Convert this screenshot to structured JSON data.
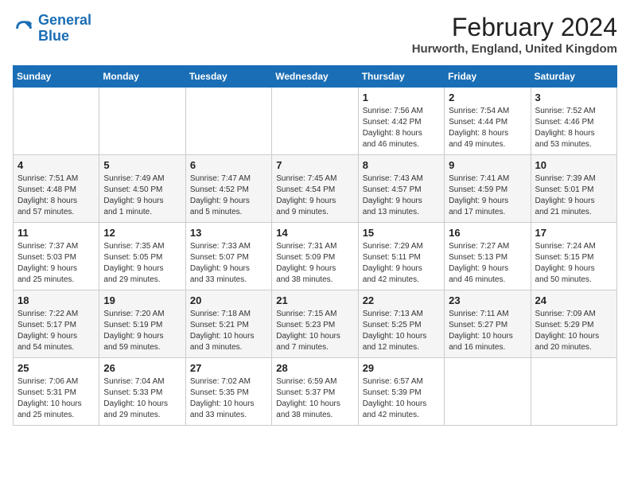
{
  "header": {
    "logo_line1": "General",
    "logo_line2": "Blue",
    "title": "February 2024",
    "subtitle": "Hurworth, England, United Kingdom"
  },
  "days_of_week": [
    "Sunday",
    "Monday",
    "Tuesday",
    "Wednesday",
    "Thursday",
    "Friday",
    "Saturday"
  ],
  "weeks": [
    [
      {
        "day": "",
        "info": ""
      },
      {
        "day": "",
        "info": ""
      },
      {
        "day": "",
        "info": ""
      },
      {
        "day": "",
        "info": ""
      },
      {
        "day": "1",
        "info": "Sunrise: 7:56 AM\nSunset: 4:42 PM\nDaylight: 8 hours\nand 46 minutes."
      },
      {
        "day": "2",
        "info": "Sunrise: 7:54 AM\nSunset: 4:44 PM\nDaylight: 8 hours\nand 49 minutes."
      },
      {
        "day": "3",
        "info": "Sunrise: 7:52 AM\nSunset: 4:46 PM\nDaylight: 8 hours\nand 53 minutes."
      }
    ],
    [
      {
        "day": "4",
        "info": "Sunrise: 7:51 AM\nSunset: 4:48 PM\nDaylight: 8 hours\nand 57 minutes."
      },
      {
        "day": "5",
        "info": "Sunrise: 7:49 AM\nSunset: 4:50 PM\nDaylight: 9 hours\nand 1 minute."
      },
      {
        "day": "6",
        "info": "Sunrise: 7:47 AM\nSunset: 4:52 PM\nDaylight: 9 hours\nand 5 minutes."
      },
      {
        "day": "7",
        "info": "Sunrise: 7:45 AM\nSunset: 4:54 PM\nDaylight: 9 hours\nand 9 minutes."
      },
      {
        "day": "8",
        "info": "Sunrise: 7:43 AM\nSunset: 4:57 PM\nDaylight: 9 hours\nand 13 minutes."
      },
      {
        "day": "9",
        "info": "Sunrise: 7:41 AM\nSunset: 4:59 PM\nDaylight: 9 hours\nand 17 minutes."
      },
      {
        "day": "10",
        "info": "Sunrise: 7:39 AM\nSunset: 5:01 PM\nDaylight: 9 hours\nand 21 minutes."
      }
    ],
    [
      {
        "day": "11",
        "info": "Sunrise: 7:37 AM\nSunset: 5:03 PM\nDaylight: 9 hours\nand 25 minutes."
      },
      {
        "day": "12",
        "info": "Sunrise: 7:35 AM\nSunset: 5:05 PM\nDaylight: 9 hours\nand 29 minutes."
      },
      {
        "day": "13",
        "info": "Sunrise: 7:33 AM\nSunset: 5:07 PM\nDaylight: 9 hours\nand 33 minutes."
      },
      {
        "day": "14",
        "info": "Sunrise: 7:31 AM\nSunset: 5:09 PM\nDaylight: 9 hours\nand 38 minutes."
      },
      {
        "day": "15",
        "info": "Sunrise: 7:29 AM\nSunset: 5:11 PM\nDaylight: 9 hours\nand 42 minutes."
      },
      {
        "day": "16",
        "info": "Sunrise: 7:27 AM\nSunset: 5:13 PM\nDaylight: 9 hours\nand 46 minutes."
      },
      {
        "day": "17",
        "info": "Sunrise: 7:24 AM\nSunset: 5:15 PM\nDaylight: 9 hours\nand 50 minutes."
      }
    ],
    [
      {
        "day": "18",
        "info": "Sunrise: 7:22 AM\nSunset: 5:17 PM\nDaylight: 9 hours\nand 54 minutes."
      },
      {
        "day": "19",
        "info": "Sunrise: 7:20 AM\nSunset: 5:19 PM\nDaylight: 9 hours\nand 59 minutes."
      },
      {
        "day": "20",
        "info": "Sunrise: 7:18 AM\nSunset: 5:21 PM\nDaylight: 10 hours\nand 3 minutes."
      },
      {
        "day": "21",
        "info": "Sunrise: 7:15 AM\nSunset: 5:23 PM\nDaylight: 10 hours\nand 7 minutes."
      },
      {
        "day": "22",
        "info": "Sunrise: 7:13 AM\nSunset: 5:25 PM\nDaylight: 10 hours\nand 12 minutes."
      },
      {
        "day": "23",
        "info": "Sunrise: 7:11 AM\nSunset: 5:27 PM\nDaylight: 10 hours\nand 16 minutes."
      },
      {
        "day": "24",
        "info": "Sunrise: 7:09 AM\nSunset: 5:29 PM\nDaylight: 10 hours\nand 20 minutes."
      }
    ],
    [
      {
        "day": "25",
        "info": "Sunrise: 7:06 AM\nSunset: 5:31 PM\nDaylight: 10 hours\nand 25 minutes."
      },
      {
        "day": "26",
        "info": "Sunrise: 7:04 AM\nSunset: 5:33 PM\nDaylight: 10 hours\nand 29 minutes."
      },
      {
        "day": "27",
        "info": "Sunrise: 7:02 AM\nSunset: 5:35 PM\nDaylight: 10 hours\nand 33 minutes."
      },
      {
        "day": "28",
        "info": "Sunrise: 6:59 AM\nSunset: 5:37 PM\nDaylight: 10 hours\nand 38 minutes."
      },
      {
        "day": "29",
        "info": "Sunrise: 6:57 AM\nSunset: 5:39 PM\nDaylight: 10 hours\nand 42 minutes."
      },
      {
        "day": "",
        "info": ""
      },
      {
        "day": "",
        "info": ""
      }
    ]
  ]
}
